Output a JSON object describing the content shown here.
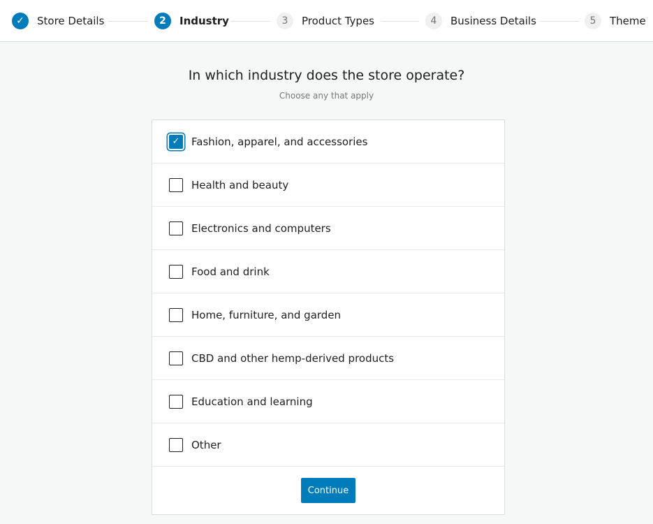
{
  "steps": [
    {
      "number": "1",
      "label": "Store Details",
      "state": "done",
      "icon": "check-icon"
    },
    {
      "number": "2",
      "label": "Industry",
      "state": "active"
    },
    {
      "number": "3",
      "label": "Product Types",
      "state": "pending"
    },
    {
      "number": "4",
      "label": "Business Details",
      "state": "pending"
    },
    {
      "number": "5",
      "label": "Theme",
      "state": "pending"
    }
  ],
  "title": "In which industry does the store operate?",
  "subtitle": "Choose any that apply",
  "options": [
    {
      "label": "Fashion, apparel, and accessories",
      "checked": true
    },
    {
      "label": "Health and beauty",
      "checked": false
    },
    {
      "label": "Electronics and computers",
      "checked": false
    },
    {
      "label": "Food and drink",
      "checked": false
    },
    {
      "label": "Home, furniture, and garden",
      "checked": false
    },
    {
      "label": "CBD and other hemp-derived products",
      "checked": false
    },
    {
      "label": "Education and learning",
      "checked": false
    },
    {
      "label": "Other",
      "checked": false
    }
  ],
  "continue_label": "Continue",
  "check_glyph": "✓",
  "colors": {
    "accent": "#007cba"
  }
}
